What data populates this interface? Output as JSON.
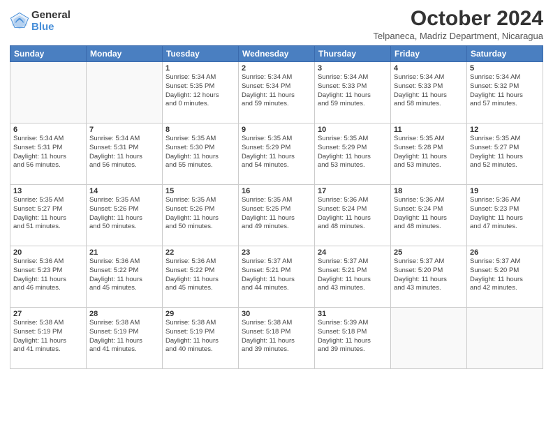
{
  "logo": {
    "general": "General",
    "blue": "Blue"
  },
  "title": "October 2024",
  "subtitle": "Telpaneca, Madriz Department, Nicaragua",
  "headers": [
    "Sunday",
    "Monday",
    "Tuesday",
    "Wednesday",
    "Thursday",
    "Friday",
    "Saturday"
  ],
  "weeks": [
    [
      {
        "day": "",
        "lines": []
      },
      {
        "day": "",
        "lines": []
      },
      {
        "day": "1",
        "lines": [
          "Sunrise: 5:34 AM",
          "Sunset: 5:35 PM",
          "Daylight: 12 hours",
          "and 0 minutes."
        ]
      },
      {
        "day": "2",
        "lines": [
          "Sunrise: 5:34 AM",
          "Sunset: 5:34 PM",
          "Daylight: 11 hours",
          "and 59 minutes."
        ]
      },
      {
        "day": "3",
        "lines": [
          "Sunrise: 5:34 AM",
          "Sunset: 5:33 PM",
          "Daylight: 11 hours",
          "and 59 minutes."
        ]
      },
      {
        "day": "4",
        "lines": [
          "Sunrise: 5:34 AM",
          "Sunset: 5:33 PM",
          "Daylight: 11 hours",
          "and 58 minutes."
        ]
      },
      {
        "day": "5",
        "lines": [
          "Sunrise: 5:34 AM",
          "Sunset: 5:32 PM",
          "Daylight: 11 hours",
          "and 57 minutes."
        ]
      }
    ],
    [
      {
        "day": "6",
        "lines": [
          "Sunrise: 5:34 AM",
          "Sunset: 5:31 PM",
          "Daylight: 11 hours",
          "and 56 minutes."
        ]
      },
      {
        "day": "7",
        "lines": [
          "Sunrise: 5:34 AM",
          "Sunset: 5:31 PM",
          "Daylight: 11 hours",
          "and 56 minutes."
        ]
      },
      {
        "day": "8",
        "lines": [
          "Sunrise: 5:35 AM",
          "Sunset: 5:30 PM",
          "Daylight: 11 hours",
          "and 55 minutes."
        ]
      },
      {
        "day": "9",
        "lines": [
          "Sunrise: 5:35 AM",
          "Sunset: 5:29 PM",
          "Daylight: 11 hours",
          "and 54 minutes."
        ]
      },
      {
        "day": "10",
        "lines": [
          "Sunrise: 5:35 AM",
          "Sunset: 5:29 PM",
          "Daylight: 11 hours",
          "and 53 minutes."
        ]
      },
      {
        "day": "11",
        "lines": [
          "Sunrise: 5:35 AM",
          "Sunset: 5:28 PM",
          "Daylight: 11 hours",
          "and 53 minutes."
        ]
      },
      {
        "day": "12",
        "lines": [
          "Sunrise: 5:35 AM",
          "Sunset: 5:27 PM",
          "Daylight: 11 hours",
          "and 52 minutes."
        ]
      }
    ],
    [
      {
        "day": "13",
        "lines": [
          "Sunrise: 5:35 AM",
          "Sunset: 5:27 PM",
          "Daylight: 11 hours",
          "and 51 minutes."
        ]
      },
      {
        "day": "14",
        "lines": [
          "Sunrise: 5:35 AM",
          "Sunset: 5:26 PM",
          "Daylight: 11 hours",
          "and 50 minutes."
        ]
      },
      {
        "day": "15",
        "lines": [
          "Sunrise: 5:35 AM",
          "Sunset: 5:26 PM",
          "Daylight: 11 hours",
          "and 50 minutes."
        ]
      },
      {
        "day": "16",
        "lines": [
          "Sunrise: 5:35 AM",
          "Sunset: 5:25 PM",
          "Daylight: 11 hours",
          "and 49 minutes."
        ]
      },
      {
        "day": "17",
        "lines": [
          "Sunrise: 5:36 AM",
          "Sunset: 5:24 PM",
          "Daylight: 11 hours",
          "and 48 minutes."
        ]
      },
      {
        "day": "18",
        "lines": [
          "Sunrise: 5:36 AM",
          "Sunset: 5:24 PM",
          "Daylight: 11 hours",
          "and 48 minutes."
        ]
      },
      {
        "day": "19",
        "lines": [
          "Sunrise: 5:36 AM",
          "Sunset: 5:23 PM",
          "Daylight: 11 hours",
          "and 47 minutes."
        ]
      }
    ],
    [
      {
        "day": "20",
        "lines": [
          "Sunrise: 5:36 AM",
          "Sunset: 5:23 PM",
          "Daylight: 11 hours",
          "and 46 minutes."
        ]
      },
      {
        "day": "21",
        "lines": [
          "Sunrise: 5:36 AM",
          "Sunset: 5:22 PM",
          "Daylight: 11 hours",
          "and 45 minutes."
        ]
      },
      {
        "day": "22",
        "lines": [
          "Sunrise: 5:36 AM",
          "Sunset: 5:22 PM",
          "Daylight: 11 hours",
          "and 45 minutes."
        ]
      },
      {
        "day": "23",
        "lines": [
          "Sunrise: 5:37 AM",
          "Sunset: 5:21 PM",
          "Daylight: 11 hours",
          "and 44 minutes."
        ]
      },
      {
        "day": "24",
        "lines": [
          "Sunrise: 5:37 AM",
          "Sunset: 5:21 PM",
          "Daylight: 11 hours",
          "and 43 minutes."
        ]
      },
      {
        "day": "25",
        "lines": [
          "Sunrise: 5:37 AM",
          "Sunset: 5:20 PM",
          "Daylight: 11 hours",
          "and 43 minutes."
        ]
      },
      {
        "day": "26",
        "lines": [
          "Sunrise: 5:37 AM",
          "Sunset: 5:20 PM",
          "Daylight: 11 hours",
          "and 42 minutes."
        ]
      }
    ],
    [
      {
        "day": "27",
        "lines": [
          "Sunrise: 5:38 AM",
          "Sunset: 5:19 PM",
          "Daylight: 11 hours",
          "and 41 minutes."
        ]
      },
      {
        "day": "28",
        "lines": [
          "Sunrise: 5:38 AM",
          "Sunset: 5:19 PM",
          "Daylight: 11 hours",
          "and 41 minutes."
        ]
      },
      {
        "day": "29",
        "lines": [
          "Sunrise: 5:38 AM",
          "Sunset: 5:19 PM",
          "Daylight: 11 hours",
          "and 40 minutes."
        ]
      },
      {
        "day": "30",
        "lines": [
          "Sunrise: 5:38 AM",
          "Sunset: 5:18 PM",
          "Daylight: 11 hours",
          "and 39 minutes."
        ]
      },
      {
        "day": "31",
        "lines": [
          "Sunrise: 5:39 AM",
          "Sunset: 5:18 PM",
          "Daylight: 11 hours",
          "and 39 minutes."
        ]
      },
      {
        "day": "",
        "lines": []
      },
      {
        "day": "",
        "lines": []
      }
    ]
  ]
}
